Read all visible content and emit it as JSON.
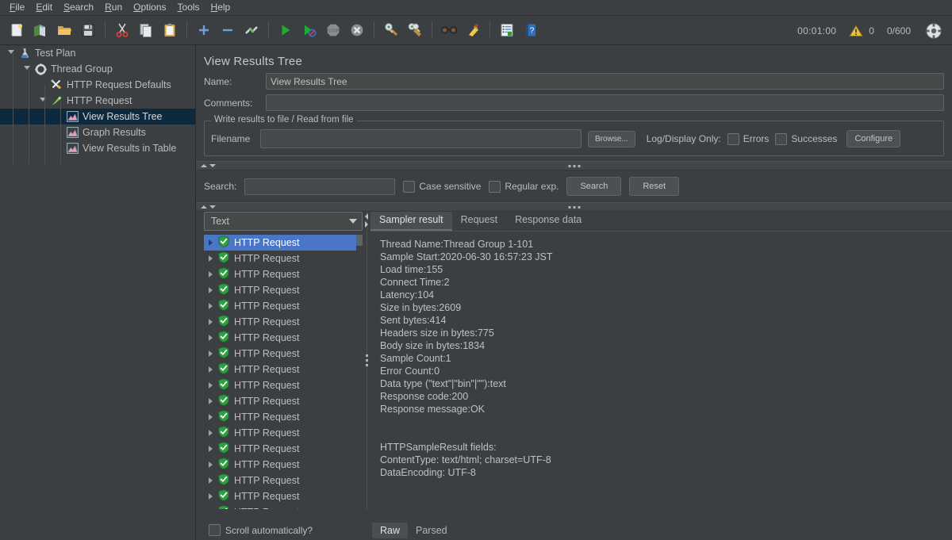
{
  "menu": {
    "items": [
      {
        "pre": "",
        "mn": "F",
        "post": "ile"
      },
      {
        "pre": "",
        "mn": "E",
        "post": "dit"
      },
      {
        "pre": "",
        "mn": "S",
        "post": "earch"
      },
      {
        "pre": "",
        "mn": "R",
        "post": "un"
      },
      {
        "pre": "",
        "mn": "O",
        "post": "ptions"
      },
      {
        "pre": "",
        "mn": "T",
        "post": "ools"
      },
      {
        "pre": "",
        "mn": "H",
        "post": "elp"
      }
    ]
  },
  "toolbar": {
    "icons": [
      "new-icon",
      "templates-icon",
      "open-icon",
      "save-icon",
      "cut-icon",
      "copy-icon",
      "paste-icon",
      "expand-all-icon",
      "collapse-all-icon",
      "toggle-icon",
      "start-icon",
      "start-no-timers-icon",
      "stop-icon",
      "shutdown-icon",
      "clear-icon",
      "clear-all-icon",
      "search-icon",
      "search-reset-icon",
      "function-helper-icon",
      "help-icon"
    ],
    "elapsed": "00:01:00",
    "warning_count": "0",
    "thread_count": "0/600",
    "status_icon": "active-threads-icon"
  },
  "tree": {
    "nodes": [
      {
        "label": "Test Plan",
        "depth": 0,
        "icon": "test-plan-icon",
        "expanded": true,
        "selected": false,
        "name": "tree-node-test-plan"
      },
      {
        "label": "Thread Group",
        "depth": 1,
        "icon": "thread-group-icon",
        "expanded": true,
        "selected": false,
        "name": "tree-node-thread-group"
      },
      {
        "label": "HTTP Request Defaults",
        "depth": 2,
        "icon": "http-defaults-icon",
        "expanded": null,
        "selected": false,
        "name": "tree-node-http-request-defaults"
      },
      {
        "label": "HTTP Request",
        "depth": 2,
        "icon": "http-request-icon",
        "expanded": true,
        "selected": false,
        "name": "tree-node-http-request"
      },
      {
        "label": "View Results Tree",
        "depth": 3,
        "icon": "listener-icon",
        "expanded": null,
        "selected": true,
        "name": "tree-node-view-results-tree"
      },
      {
        "label": "Graph Results",
        "depth": 3,
        "icon": "listener-icon",
        "expanded": null,
        "selected": false,
        "name": "tree-node-graph-results"
      },
      {
        "label": "View Results in Table",
        "depth": 3,
        "icon": "listener-icon",
        "expanded": null,
        "selected": false,
        "name": "tree-node-view-results-in-table"
      }
    ]
  },
  "panel": {
    "title": "View Results Tree",
    "name_label": "Name:",
    "name_value": "View Results Tree",
    "comments_label": "Comments:",
    "comments_value": "",
    "comments_placeholder": ""
  },
  "file_group": {
    "title": "Write results to file / Read from file",
    "filename_label": "Filename",
    "filename_value": "",
    "browse_label": "Browse...",
    "logdisplay_label": "Log/Display Only:",
    "errors_label": "Errors",
    "errors_checked": false,
    "successes_label": "Successes",
    "successes_checked": false,
    "configure_label": "Configure"
  },
  "search": {
    "label": "Search:",
    "value": "",
    "case_sensitive_label": "Case sensitive",
    "case_sensitive_checked": false,
    "regular_exp_label": "Regular exp.",
    "regular_exp_checked": false,
    "search_button": "Search",
    "reset_button": "Reset"
  },
  "results": {
    "render_selected": "Text",
    "render_options": [
      "Text"
    ],
    "sampler_label": "HTTP Request",
    "sampler_rows": 19,
    "selected_index": 0,
    "scroll_label": "Scroll automatically?",
    "scroll_checked": false
  },
  "tabs": {
    "items": [
      "Sampler result",
      "Request",
      "Response data"
    ],
    "active": "Sampler result"
  },
  "sampler_result": {
    "lines": [
      "Thread Name:Thread Group 1-101",
      "Sample Start:2020-06-30 16:57:23 JST",
      "Load time:155",
      "Connect Time:2",
      "Latency:104",
      "Size in bytes:2609",
      "Sent bytes:414",
      "Headers size in bytes:775",
      "Body size in bytes:1834",
      "Sample Count:1",
      "Error Count:0",
      "Data type (\"text\"|\"bin\"|\"\"):text",
      "Response code:200",
      "Response message:OK",
      "",
      "",
      "HTTPSampleResult fields:",
      "ContentType: text/html; charset=UTF-8",
      "DataEncoding: UTF-8"
    ]
  },
  "view_tabs": {
    "items": [
      "Raw",
      "Parsed"
    ],
    "active": "Raw"
  },
  "colors": {
    "background": "#3c3f41",
    "selection_blue": "#4a76c8",
    "tree_selection": "#0d293e",
    "accent_green": "#2f9e41",
    "field_bg": "#45494a",
    "text": "#bbbbbb"
  }
}
